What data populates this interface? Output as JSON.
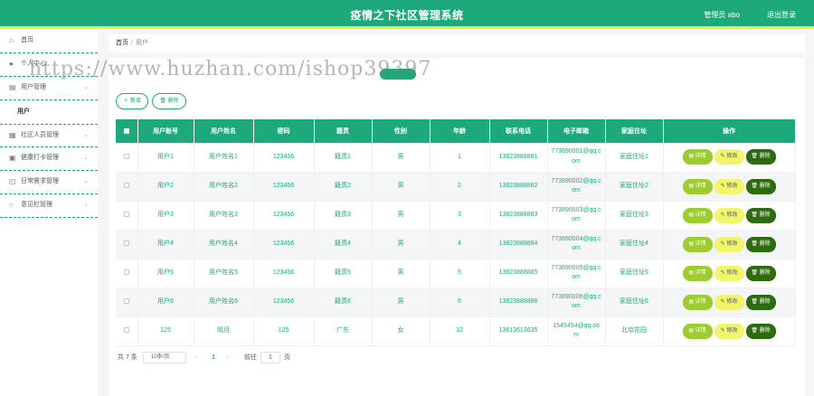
{
  "header": {
    "title": "疫情之下社区管理系统",
    "user_label": "管理员 abo",
    "logout_label": "退出登录"
  },
  "sidebar": {
    "items": [
      {
        "label": "首页",
        "icon": "home-icon"
      },
      {
        "label": "个人中心",
        "icon": "user-icon"
      },
      {
        "label": "用户管理",
        "icon": "users-icon"
      },
      {
        "label": "社区人员管理",
        "icon": "grid-icon"
      },
      {
        "label": "健康打卡管理",
        "icon": "clipboard-icon"
      },
      {
        "label": "日常需求管理",
        "icon": "bag-icon"
      },
      {
        "label": "意见栏管理",
        "icon": "circle-icon"
      }
    ],
    "sub_active": "用户"
  },
  "breadcrumb": {
    "home": "首页",
    "sep": "/",
    "current": "用户"
  },
  "watermark": "https://www.huzhan.com/ishop39397",
  "actions": {
    "add": "新增",
    "delete": "删除"
  },
  "table": {
    "headers": [
      "用户账号",
      "用户姓名",
      "密码",
      "籍贯",
      "性别",
      "年龄",
      "联系电话",
      "电子邮箱",
      "家庭住址",
      "操作"
    ],
    "rows": [
      [
        "用户1",
        "用户姓名1",
        "123456",
        "籍贯1",
        "男",
        "1",
        "13823888881",
        "773890001@qq.com",
        "家庭住址1"
      ],
      [
        "用户2",
        "用户姓名2",
        "123456",
        "籍贯2",
        "男",
        "2",
        "13823888882",
        "773890002@qq.com",
        "家庭住址2"
      ],
      [
        "用户3",
        "用户姓名3",
        "123456",
        "籍贯3",
        "男",
        "3",
        "13823888883",
        "773890003@qq.com",
        "家庭住址3"
      ],
      [
        "用户4",
        "用户姓名4",
        "123456",
        "籍贯4",
        "男",
        "4",
        "13823888884",
        "773890004@qq.com",
        "家庭住址4"
      ],
      [
        "用户5",
        "用户姓名5",
        "123456",
        "籍贯5",
        "男",
        "5",
        "13823888885",
        "773890005@qq.com",
        "家庭住址5"
      ],
      [
        "用户6",
        "用户姓名6",
        "123456",
        "籍贯6",
        "男",
        "6",
        "13823888886",
        "773890006@qq.com",
        "家庭住址6"
      ],
      [
        "125",
        "晓月",
        "125",
        "广东",
        "女",
        "32",
        "13613613635",
        "1545454@qq.com",
        "北京花园"
      ]
    ],
    "op_detail": "详情",
    "op_edit": "修改",
    "op_delete": "删除"
  },
  "pager": {
    "total": "共 7 条",
    "page_size": "10条/页",
    "prev": "‹",
    "page": "1",
    "next": "›",
    "goto_label": "前往",
    "goto_value": "1",
    "page_unit": "页"
  },
  "colors": {
    "primary": "#1ea97c",
    "accent": "#e9f24d",
    "detail": "#9ccc2e",
    "edit": "#f0f56c",
    "delete": "#2e6b0e"
  }
}
